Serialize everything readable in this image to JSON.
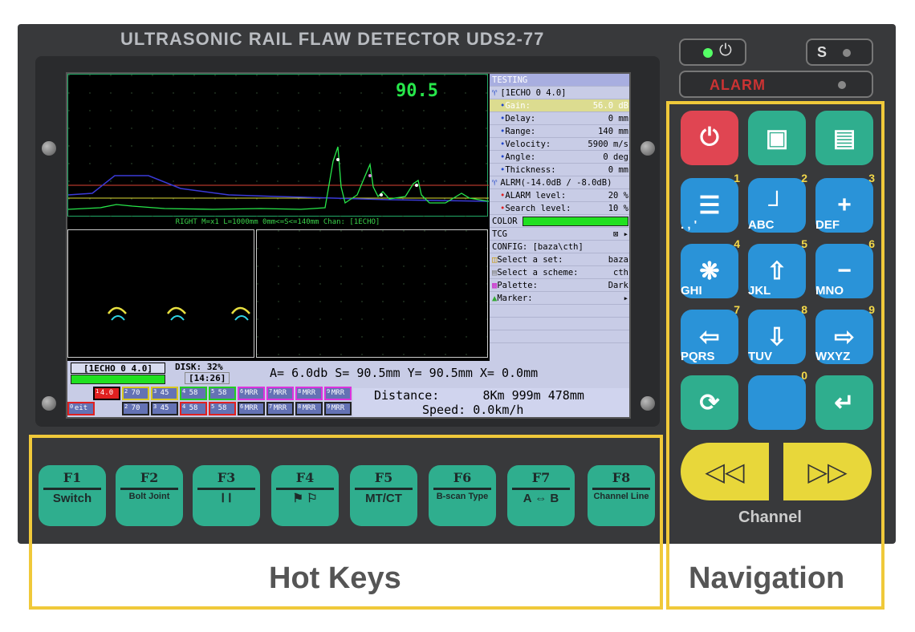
{
  "device": {
    "title": "ULTRASONIC RAIL FLAW DETECTOR UDS2-77",
    "alarm_label": "ALARM",
    "s_label": "S",
    "channel_label": "Channel"
  },
  "ascan": {
    "peak_value": "90.5",
    "status_line": "RIGHT M=x1  L=1000mm 0mm<=S<=140mm Chan: [1ECHO]"
  },
  "panel": {
    "testing": "TESTING",
    "channel": "[1ECHO 0 4.0]",
    "params": [
      {
        "label": "Gain:",
        "value": "56.0 dB"
      },
      {
        "label": "Delay:",
        "value": "0 mm"
      },
      {
        "label": "Range:",
        "value": "140 mm"
      },
      {
        "label": "Velocity:",
        "value": "5900 m/s"
      },
      {
        "label": "Angle:",
        "value": "0 deg"
      },
      {
        "label": "Thickness:",
        "value": "0 mm"
      }
    ],
    "alarm_header": "ALRM(-14.0dB / -8.0dB)",
    "alarm_params": [
      {
        "label": "ALARM level:",
        "value": "20 %"
      },
      {
        "label": "Search level:",
        "value": "10 %"
      }
    ],
    "color_label": "COLOR",
    "tcg_label": "TCG",
    "config": "CONFIG: [baza\\cth]",
    "config_items": [
      {
        "label": "Select a set:",
        "value": "baza"
      },
      {
        "label": "Select a scheme:",
        "value": "cth"
      },
      {
        "label": "Palette:",
        "value": "Dark"
      },
      {
        "label": "Marker:",
        "value": ""
      }
    ]
  },
  "bottom": {
    "channel_box": "[1ECHO 0 4.0]",
    "disk": "DISK: 32%",
    "time": "[14:26]",
    "measurements": "A= 6.0db S= 90.5mm Y= 90.5mm X=  0.0mm",
    "distance_label": "Distance:",
    "distance_value": "8Km 999m 478mm",
    "speed_label": "Speed:",
    "speed_value": "0.0km/h",
    "chips_top": [
      {
        "n": "1",
        "v": "4.0"
      },
      {
        "n": "2",
        "v": "70"
      },
      {
        "n": "3",
        "v": "45"
      },
      {
        "n": "4",
        "v": "58"
      },
      {
        "n": "5",
        "v": "58"
      },
      {
        "n": "6",
        "v": "MRR"
      },
      {
        "n": "7",
        "v": "MRR"
      },
      {
        "n": "8",
        "v": "MRR"
      },
      {
        "n": "9",
        "v": "MRR"
      }
    ],
    "chips_bottom": [
      {
        "n": "0",
        "v": "eit"
      },
      {
        "n": "2",
        "v": "70"
      },
      {
        "n": "3",
        "v": "45"
      },
      {
        "n": "4",
        "v": "58"
      },
      {
        "n": "5",
        "v": "58"
      },
      {
        "n": "6",
        "v": "MRR"
      },
      {
        "n": "7",
        "v": "MRR"
      },
      {
        "n": "8",
        "v": "MRR"
      },
      {
        "n": "9",
        "v": "MRR"
      }
    ]
  },
  "hotkeys": [
    {
      "fn": "F1",
      "caption": "Switch"
    },
    {
      "fn": "F2",
      "caption": "Bolt Joint"
    },
    {
      "fn": "F3",
      "caption": "Ⅰ Ⅰ"
    },
    {
      "fn": "F4",
      "caption": "⚑ ⚐"
    },
    {
      "fn": "F5",
      "caption": "MT/CT"
    },
    {
      "fn": "F6",
      "caption": "B-scan Type"
    },
    {
      "fn": "F7",
      "caption": "A ⇔ B"
    },
    {
      "fn": "F8",
      "caption": "Channel Line"
    }
  ],
  "nav": {
    "keys": [
      {
        "num": "1",
        "label": ". , '"
      },
      {
        "num": "2",
        "label": "ABC"
      },
      {
        "num": "3",
        "label": "DEF"
      },
      {
        "num": "4",
        "label": "GHI"
      },
      {
        "num": "5",
        "label": "JKL"
      },
      {
        "num": "6",
        "label": "MNO"
      },
      {
        "num": "7",
        "label": "PQRS"
      },
      {
        "num": "8",
        "label": "TUV"
      },
      {
        "num": "9",
        "label": "WXYZ"
      },
      {
        "num": "0",
        "label": ""
      }
    ]
  },
  "labels": {
    "hot_keys": "Hot Keys",
    "navigation": "Navigation"
  },
  "colors": {
    "accent_yellow": "#f0c93a",
    "key_teal": "#2fae8e",
    "key_blue": "#2a93d8",
    "power_red": "#e04552",
    "trace_green": "#27e64a"
  }
}
